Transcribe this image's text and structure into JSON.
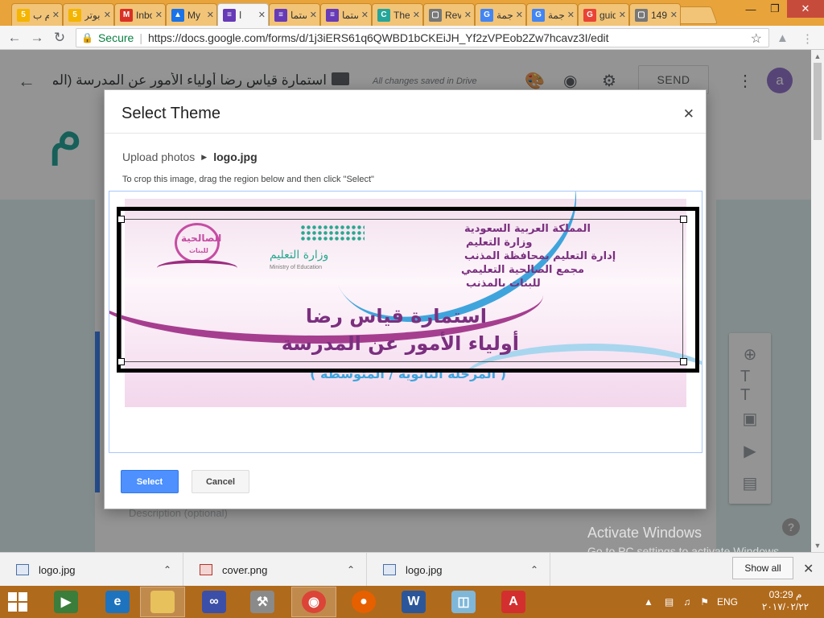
{
  "browser": {
    "tabs": [
      {
        "title": "أقوم ب",
        "favicon": "5",
        "color": "#f4b400"
      },
      {
        "title": "ابوتر",
        "favicon": "5",
        "color": "#f4b400"
      },
      {
        "title": "Inbo",
        "favicon": "M",
        "color": "#d93025"
      },
      {
        "title": "My D",
        "favicon": "▲",
        "color": "#1a73e8"
      },
      {
        "title": "ا",
        "favicon": "≡",
        "color": "#673ab7",
        "active": true
      },
      {
        "title": "استما",
        "favicon": "≡",
        "color": "#673ab7"
      },
      {
        "title": "استما",
        "favicon": "≡",
        "color": "#673ab7"
      },
      {
        "title": "The",
        "favicon": "C",
        "color": "#26a69a"
      },
      {
        "title": "Revi",
        "favicon": "▢",
        "color": "#777777"
      },
      {
        "title": "ترجمة",
        "favicon": "G",
        "color": "#4285f4"
      },
      {
        "title": "ترجمة",
        "favicon": "G",
        "color": "#4285f4"
      },
      {
        "title": "guid",
        "favicon": "G",
        "color": "#ea4335"
      },
      {
        "title": "1490",
        "favicon": "▢",
        "color": "#777777"
      }
    ],
    "secure_label": "Secure",
    "url": "https://docs.google.com/forms/d/1j3iERS61q6QWBD1bCKEiJH_Yf2zVPEob2Zw7hcavz3I/edit"
  },
  "forms_header": {
    "title": "استمارة قياس رضا أولياء الأمور عن المدرسة (المر",
    "saved_status": "All changes saved in Drive",
    "send_label": "SEND",
    "avatar_letter": "a"
  },
  "form_card": {
    "description_placeholder": "Description (optional)"
  },
  "dialog": {
    "title": "Select Theme",
    "breadcrumb_root": "Upload photos",
    "breadcrumb_file": "logo.jpg",
    "instructions": "To crop this image, drag the region below and then click \"Select\"",
    "select_label": "Select",
    "cancel_label": "Cancel"
  },
  "banner": {
    "kingdom": "المملكة العربية السعودية",
    "ministry": "وزارة التعليم",
    "directorate": "إدارة التعليم بمحافظة المذنب",
    "complex": "مجمع الصالحية التعليمي",
    "girls": "للبنات بالمذنب",
    "moe_ar": "وزارة التعليم",
    "moe_en": "Ministry of Education",
    "heading1": "استمارة قياس رضا",
    "heading2": "أولياء الأمور عن المدرسة",
    "heading3": "( المرحلة الثانوية / المتوسطة )",
    "school_name": "الصالحية",
    "school_sub": "للبنات"
  },
  "watermark": {
    "line1": "Activate Windows",
    "line2": "Go to PC settings to activate Windows."
  },
  "downloads": [
    {
      "name": "logo.jpg",
      "kind": "jpg"
    },
    {
      "name": "cover.png",
      "kind": "png"
    },
    {
      "name": "logo.jpg",
      "kind": "jpg"
    }
  ],
  "downloads_show_all": "Show all",
  "taskbar": {
    "language": "ENG",
    "time": "03:29 م",
    "date": "٢٠١٧/٠٢/٢٢"
  },
  "colors": {
    "brand_purple": "#673ab7",
    "send_text": "#5f6368",
    "select_button": "#4d90fe",
    "taskbar": "#b06a1c"
  }
}
